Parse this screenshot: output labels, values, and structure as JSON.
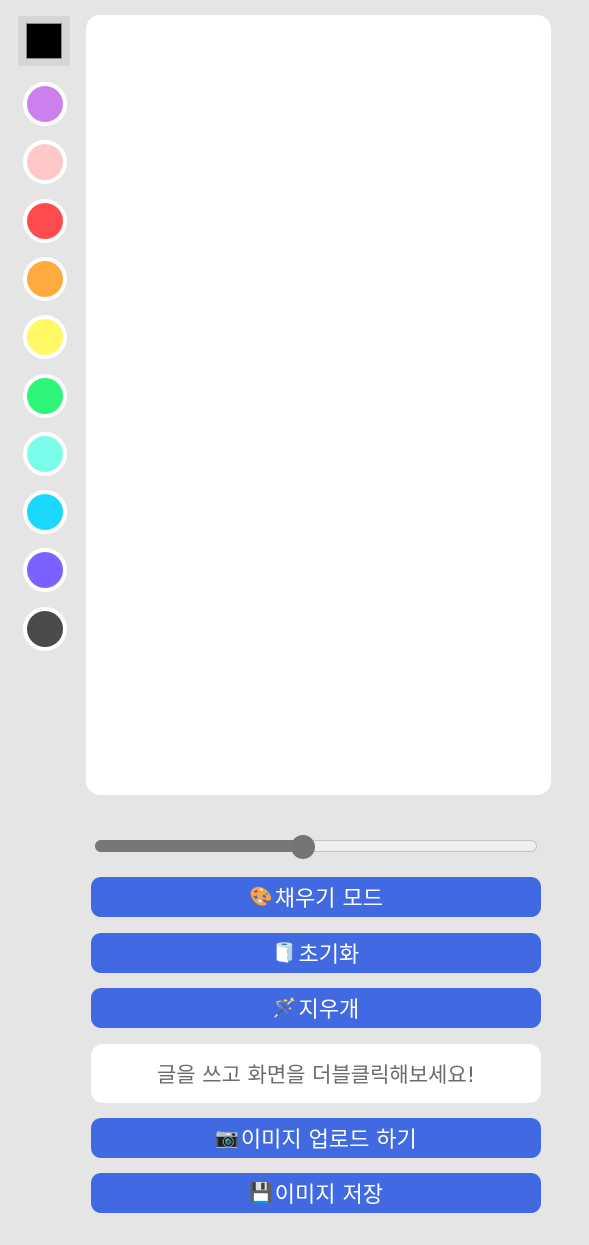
{
  "palette": {
    "picker_color": "#000000",
    "colors": [
      "#cc80ee",
      "#ffc8c8",
      "#ff4b4b",
      "#ffaa3c",
      "#fff964",
      "#2ef57a",
      "#7afce9",
      "#1bd8ff",
      "#7b61ff",
      "#4a4a4a"
    ]
  },
  "line_width": {
    "fraction": 0.47
  },
  "buttons": {
    "fill_mode": {
      "icon": "🎨",
      "label": "채우기 모드"
    },
    "reset": {
      "icon": "🧻",
      "label": "초기화"
    },
    "eraser": {
      "icon": "🪄",
      "label": "지우개"
    },
    "upload": {
      "icon": "📷",
      "label": "이미지 업로드 하기"
    },
    "save": {
      "icon": "💾",
      "label": "이미지 저장"
    }
  },
  "text_input": {
    "placeholder": "글을 쓰고 화면을 더블클릭해보세요!"
  }
}
